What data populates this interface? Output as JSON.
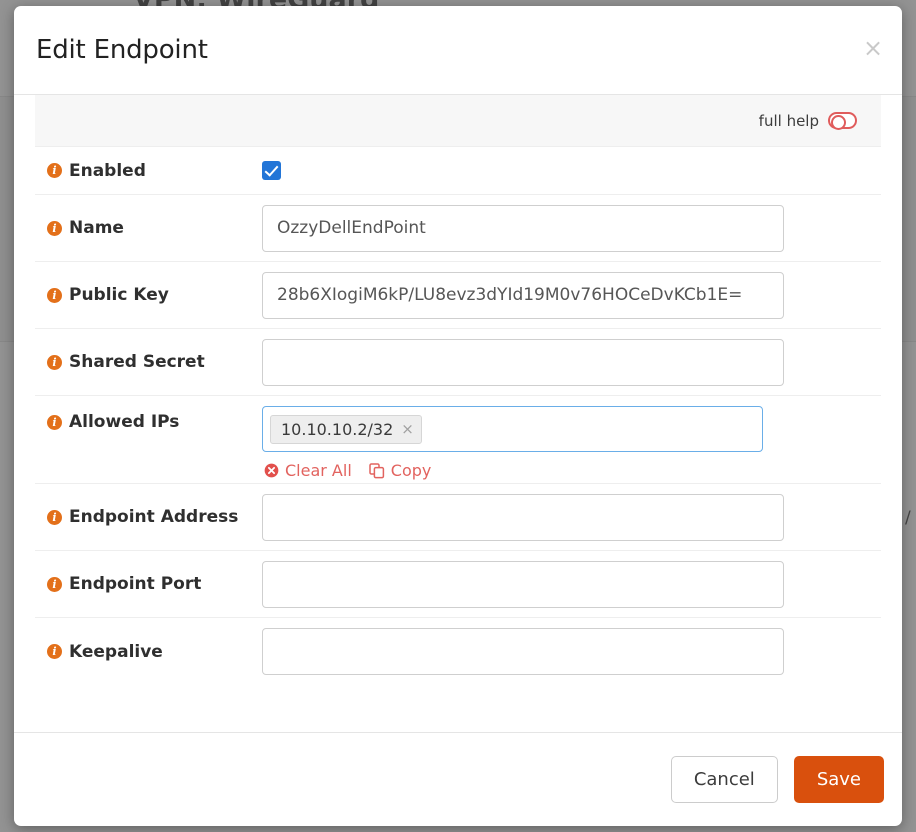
{
  "background": {
    "page_heading": "VPN: WireGuard"
  },
  "modal": {
    "title": "Edit Endpoint",
    "close_icon_label": "×",
    "help": {
      "label": "full help",
      "toggle_state": "off",
      "toggle_color": "#e05c5c"
    },
    "fields": [
      {
        "label": "Enabled",
        "type": "checkbox",
        "checked": true,
        "checkbox_color": "#2275d7"
      },
      {
        "label": "Name",
        "type": "text",
        "value": "OzzyDellEndPoint",
        "placeholder": ""
      },
      {
        "label": "Public Key",
        "type": "text",
        "value": "28b6XIogiM6kP/LU8evz3dYId19M0v76HOCeDvKCb1E=",
        "placeholder": ""
      },
      {
        "label": "Shared Secret",
        "type": "text",
        "value": "",
        "placeholder": ""
      },
      {
        "label": "Allowed IPs",
        "type": "tags",
        "tags": [
          "10.10.10.2/32"
        ],
        "tag_remove_label": "×",
        "actions": [
          {
            "label": "Clear All",
            "icon": "clear-all-icon"
          },
          {
            "label": "Copy",
            "icon": "copy-icon"
          }
        ],
        "action_color": "#e2635f"
      },
      {
        "label": "Endpoint Address",
        "type": "text",
        "value": "",
        "placeholder": ""
      },
      {
        "label": "Endpoint Port",
        "type": "text",
        "value": "",
        "placeholder": ""
      },
      {
        "label": "Keepalive",
        "type": "text",
        "value": "",
        "placeholder": ""
      }
    ],
    "footer": {
      "cancel_label": "Cancel",
      "save_label": "Save",
      "save_color": "#d9500d"
    }
  },
  "info_icon_color": "#e3701a"
}
